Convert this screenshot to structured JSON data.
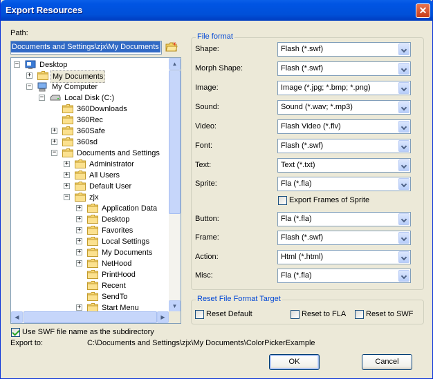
{
  "window": {
    "title": "Export Resources",
    "close_glyph": "✕"
  },
  "path": {
    "label": "Path:",
    "value": "Documents and Settings\\zjx\\My Documents"
  },
  "tree": {
    "items": [
      {
        "label": "Desktop",
        "level": 0,
        "icon": "desktop-icon",
        "expander": "minus"
      },
      {
        "label": "My Documents",
        "level": 1,
        "icon": "folder-icon",
        "expander": "plus",
        "selected": true
      },
      {
        "label": "My Computer",
        "level": 1,
        "icon": "computer-icon",
        "expander": "minus"
      },
      {
        "label": "Local Disk (C:)",
        "level": 2,
        "icon": "drive-icon",
        "expander": "minus"
      },
      {
        "label": "360Downloads",
        "level": 3,
        "icon": "folder-icon",
        "expander": ""
      },
      {
        "label": "360Rec",
        "level": 3,
        "icon": "folder-icon",
        "expander": ""
      },
      {
        "label": "360Safe",
        "level": 3,
        "icon": "folder-icon",
        "expander": "plus"
      },
      {
        "label": "360sd",
        "level": 3,
        "icon": "folder-icon",
        "expander": "plus"
      },
      {
        "label": "Documents and Settings",
        "level": 3,
        "icon": "folder-icon",
        "expander": "minus"
      },
      {
        "label": "Administrator",
        "level": 4,
        "icon": "folder-icon",
        "expander": "plus"
      },
      {
        "label": "All Users",
        "level": 4,
        "icon": "folder-icon",
        "expander": "plus"
      },
      {
        "label": "Default User",
        "level": 4,
        "icon": "folder-icon",
        "expander": "plus"
      },
      {
        "label": "zjx",
        "level": 4,
        "icon": "folder-icon",
        "expander": "minus"
      },
      {
        "label": "Application Data",
        "level": 5,
        "icon": "folder-icon",
        "expander": "plus"
      },
      {
        "label": "Desktop",
        "level": 5,
        "icon": "folder-icon",
        "expander": "plus"
      },
      {
        "label": "Favorites",
        "level": 5,
        "icon": "folder-icon",
        "expander": "plus"
      },
      {
        "label": "Local Settings",
        "level": 5,
        "icon": "folder-icon",
        "expander": "plus"
      },
      {
        "label": "My Documents",
        "level": 5,
        "icon": "folder-icon",
        "expander": "plus"
      },
      {
        "label": "NetHood",
        "level": 5,
        "icon": "folder-icon",
        "expander": "plus"
      },
      {
        "label": "PrintHood",
        "level": 5,
        "icon": "folder-icon",
        "expander": ""
      },
      {
        "label": "Recent",
        "level": 5,
        "icon": "folder-icon",
        "expander": ""
      },
      {
        "label": "SendTo",
        "level": 5,
        "icon": "folder-icon",
        "expander": ""
      },
      {
        "label": "Start Menu",
        "level": 5,
        "icon": "folder-icon",
        "expander": "plus"
      }
    ]
  },
  "use_swf_subdir": {
    "label": "Use SWF file name as the subdirectory",
    "checked": true
  },
  "export_to": {
    "label": "Export to:",
    "value": "C:\\Documents and Settings\\zjx\\My Documents\\ColorPickerExample"
  },
  "file_format": {
    "title": "File format",
    "rows": [
      {
        "label": "Shape:",
        "value": "Flash (*.swf)"
      },
      {
        "label": "Morph Shape:",
        "value": "Flash (*.swf)"
      },
      {
        "label": "Image:",
        "value": "Image (*.jpg; *.bmp; *.png)"
      },
      {
        "label": "Sound:",
        "value": "Sound (*.wav; *.mp3)"
      },
      {
        "label": "Video:",
        "value": "Flash Video (*.flv)"
      },
      {
        "label": "Font:",
        "value": "Flash (*.swf)"
      },
      {
        "label": "Text:",
        "value": "Text (*.txt)"
      },
      {
        "label": "Sprite:",
        "value": "Fla (*.fla)"
      },
      {
        "label": "Button:",
        "value": "Fla (*.fla)"
      },
      {
        "label": "Frame:",
        "value": "Flash (*.swf)"
      },
      {
        "label": "Action:",
        "value": "Html (*.html)"
      },
      {
        "label": "Misc:",
        "value": "Fla (*.fla)"
      }
    ],
    "export_frames": {
      "label": "Export Frames of Sprite",
      "checked": false
    }
  },
  "reset": {
    "title": "Reset File Format Target",
    "default_label": "Reset Default",
    "fla_label": "Reset to FLA",
    "swf_label": "Reset to SWF"
  },
  "buttons": {
    "ok": "OK",
    "cancel": "Cancel"
  },
  "colors": {
    "title_bar": "#0054e3",
    "group_title": "#0046d5",
    "selection": "#316ac5"
  }
}
